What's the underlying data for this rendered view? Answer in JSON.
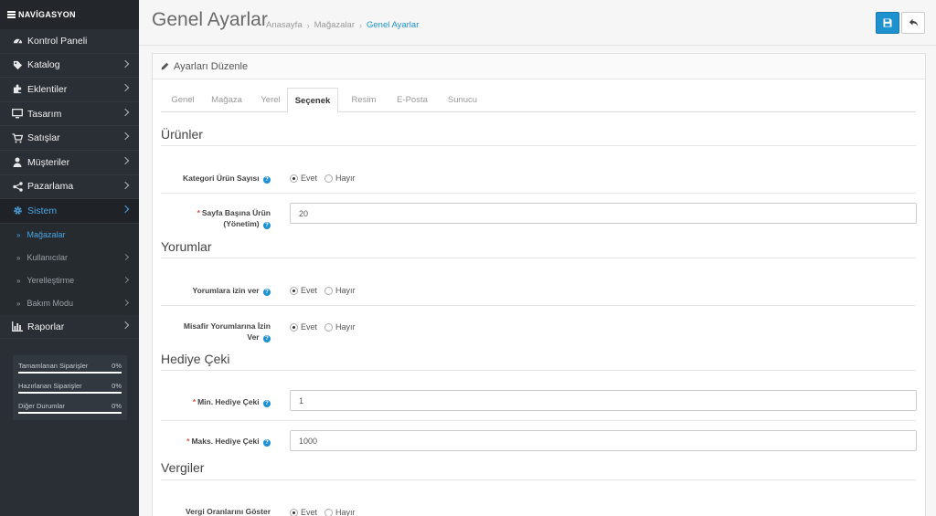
{
  "sidebar": {
    "heading": "NAVİGASYON",
    "items": [
      {
        "label": "Kontrol Paneli"
      },
      {
        "label": "Katalog"
      },
      {
        "label": "Eklentiler"
      },
      {
        "label": "Tasarım"
      },
      {
        "label": "Satışlar"
      },
      {
        "label": "Müşteriler"
      },
      {
        "label": "Pazarlama"
      },
      {
        "label": "Sistem"
      }
    ],
    "sub_items": [
      {
        "label": "Mağazalar"
      },
      {
        "label": "Kullanıcılar"
      },
      {
        "label": "Yerelleştirme"
      },
      {
        "label": "Bakım Modu"
      }
    ],
    "reports": {
      "label": "Raporlar"
    },
    "stats": [
      {
        "label": "Tamamlanan Siparişler",
        "value": "0%"
      },
      {
        "label": "Hazırlanan Siparişler",
        "value": "0%"
      },
      {
        "label": "Diğer Durumlar",
        "value": "0%"
      }
    ],
    "accent_color": "#4aa3df"
  },
  "header": {
    "title": "Genel Ayarlar",
    "breadcrumb": [
      "Anasayfa",
      "Mağazalar",
      "Genel Ayarlar"
    ],
    "save_icon": "save-icon",
    "back_icon": "reply-icon",
    "primary_color": "#1e91cf"
  },
  "panel": {
    "title": "Ayarları Düzenle",
    "tabs": [
      "Genel",
      "Mağaza",
      "Yerel",
      "Seçenek",
      "Resim",
      "E-Posta",
      "Sunucu"
    ],
    "active_tab": "Seçenek"
  },
  "form": {
    "radio_yes": "Evet",
    "radio_no": "Hayır",
    "sections": {
      "products": "Ürünler",
      "reviews": "Yorumlar",
      "voucher": "Hediye Çeki",
      "taxes": "Vergiler"
    },
    "fields": {
      "product_count": {
        "label": "Kategori Ürün Sayısı"
      },
      "per_page": {
        "label_line1": "Sayfa Başına Ürün",
        "label_line2": "(Yönetim)",
        "value": "20"
      },
      "review_allow": {
        "label": "Yorumlara izin ver"
      },
      "guest_review": {
        "label_line1": "Misafir Yorumlarına İzin",
        "label_line2": "Ver"
      },
      "voucher_min": {
        "label": "Min. Hediye Çeki",
        "value": "1"
      },
      "voucher_max": {
        "label": "Maks. Hediye Çeki",
        "value": "1000"
      },
      "tax_display": {
        "label": "Vergi Oranlarını Göster"
      }
    }
  }
}
